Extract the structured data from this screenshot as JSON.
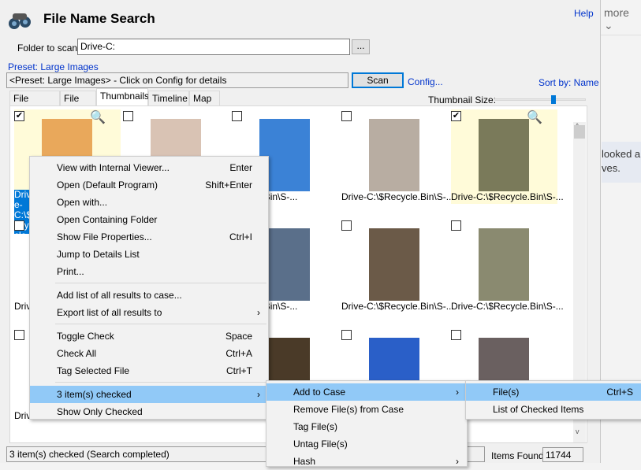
{
  "background": {
    "more_label": "more",
    "text_lines": [
      "looked a",
      "ves."
    ]
  },
  "app": {
    "title": "File Name Search",
    "help": "Help"
  },
  "folder": {
    "label": "Folder to scan:",
    "value": "Drive-C:",
    "browse": "..."
  },
  "preset": {
    "link": "Preset: Large Images",
    "value": "<Preset: Large Images> - Click on Config for details",
    "scan": "Scan",
    "config": "Config...",
    "sort": "Sort by: Name"
  },
  "tabs": [
    {
      "label": "File Details"
    },
    {
      "label": "File List"
    },
    {
      "label": "Thumbnails",
      "active": true
    },
    {
      "label": "Timeline"
    },
    {
      "label": "Map"
    }
  ],
  "thumbnail_size": {
    "label": "Thumbnail Size:",
    "level": 0.75
  },
  "thumbnails": [
    {
      "label": "Drive-C:\\$Recycle.Bin\\S-1-5-21-...83-2...",
      "checked": true,
      "selected": true,
      "color": "#e9a85b"
    },
    {
      "label": "",
      "checked": false,
      "color": "#d9c3b4"
    },
    {
      "label": "$Recycle.Bin\\S-...",
      "checked": false,
      "color": "#3b82d6"
    },
    {
      "label": "Drive-C:\\$Recycle.Bin\\S-...",
      "checked": false,
      "color": "#b8ada2"
    },
    {
      "label": "Drive-C:\\$Recycle.Bin\\S-...",
      "checked": true,
      "color": "#7a7a5a"
    },
    {
      "label": "Driv",
      "checked": false,
      "color": "#555"
    },
    {
      "label": "",
      "checked": false,
      "color": "#ccc"
    },
    {
      "label": "$Recycle.Bin\\S-...",
      "checked": false,
      "color": "#5a6f8a"
    },
    {
      "label": "Drive-C:\\$Recycle.Bin\\S-...",
      "checked": false,
      "color": "#6b5a48"
    },
    {
      "label": "Drive-C:\\$Recycle.Bin\\S-...",
      "checked": false,
      "color": "#8a8a70"
    },
    {
      "label": "Driv",
      "checked": false,
      "color": "#ddd"
    },
    {
      "label": "",
      "checked": false,
      "color": "#ccc"
    },
    {
      "label": "",
      "checked": false,
      "color": "#4a3a28"
    },
    {
      "label": "",
      "checked": false,
      "color": "#2a5fc8"
    },
    {
      "label": "",
      "checked": false,
      "color": "#6a6060"
    }
  ],
  "context_menu": {
    "items": [
      {
        "label": "View with Internal Viewer...",
        "shortcut": "Enter"
      },
      {
        "label": "Open (Default Program)",
        "shortcut": "Shift+Enter"
      },
      {
        "label": "Open with..."
      },
      {
        "label": "Open Containing Folder"
      },
      {
        "label": "Show File Properties...",
        "shortcut": "Ctrl+I"
      },
      {
        "label": "Jump to Details List"
      },
      {
        "label": "Print..."
      },
      {
        "label": "Add list of all results to case..."
      },
      {
        "label": "Export list of all results to",
        "submenu": true
      },
      {
        "label": "Toggle Check",
        "shortcut": "Space"
      },
      {
        "label": "Check All",
        "shortcut": "Ctrl+A"
      },
      {
        "label": "Tag Selected File",
        "shortcut": "Ctrl+T"
      },
      {
        "label": "3 item(s) checked",
        "submenu": true,
        "highlighted": true
      },
      {
        "label": "Show Only Checked"
      }
    ]
  },
  "submenu_checked": {
    "items": [
      {
        "label": "Add to Case",
        "submenu": true,
        "highlighted": true
      },
      {
        "label": "Remove File(s) from Case"
      },
      {
        "label": "Tag File(s)"
      },
      {
        "label": "Untag File(s)"
      },
      {
        "label": "Hash",
        "submenu": true
      }
    ]
  },
  "submenu_add": {
    "items": [
      {
        "label": "File(s)",
        "shortcut": "Ctrl+S",
        "highlighted": true
      },
      {
        "label": "List of Checked Items"
      }
    ]
  },
  "status": {
    "text": "3 item(s) checked (Search completed)",
    "items_found_label": "Items Found:",
    "items_found": "11744"
  },
  "colors": {
    "highlight": "#91c9f7",
    "selection": "#0078d7",
    "link": "#0033cc"
  }
}
